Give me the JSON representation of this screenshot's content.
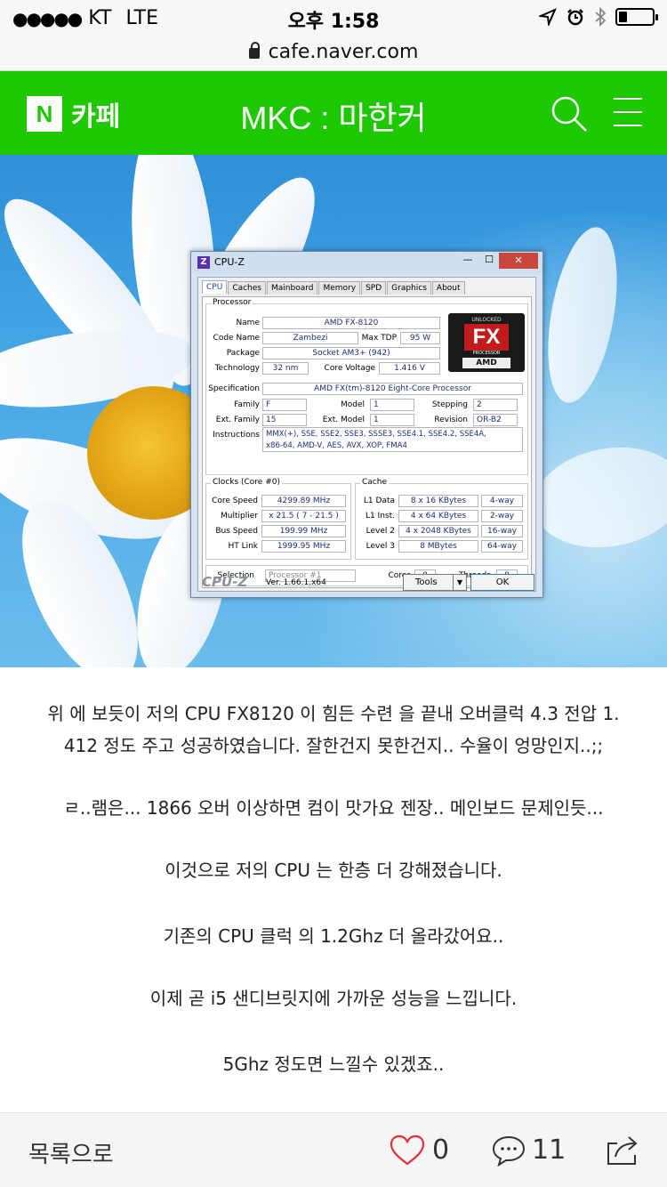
{
  "status_bar": {
    "signal": "●●●●●",
    "carrier": "KT",
    "network": "LTE",
    "time": "오후 1:58",
    "icons": [
      "location-arrow-icon",
      "alarm-icon",
      "bluetooth-icon",
      "battery-icon"
    ],
    "battery_level": 0.25
  },
  "url_bar": {
    "domain": "cafe.naver.com"
  },
  "header": {
    "logo_letter": "N",
    "logo_text": "카페",
    "title": "MKC : 마한커",
    "brand_color": "#1ec800"
  },
  "cpuz": {
    "title": "CPU-Z",
    "window_buttons": {
      "min": "—",
      "max": "☐",
      "close": "✕"
    },
    "tabs": [
      "CPU",
      "Caches",
      "Mainboard",
      "Memory",
      "SPD",
      "Graphics",
      "About"
    ],
    "active_tab": "CPU",
    "processor": {
      "group_label": "Processor",
      "name_label": "Name",
      "name": "AMD FX-8120",
      "codename_label": "Code Name",
      "codename": "Zambezi",
      "maxtdp_label": "Max TDP",
      "maxtdp": "95 W",
      "package_label": "Package",
      "package": "Socket AM3+ (942)",
      "technology_label": "Technology",
      "technology": "32 nm",
      "corevoltage_label": "Core Voltage",
      "corevoltage": "1.416 V",
      "spec_label": "Specification",
      "spec": "AMD FX(tm)-8120 Eight-Core Processor",
      "family_label": "Family",
      "family": "F",
      "model_label": "Model",
      "model": "1",
      "stepping_label": "Stepping",
      "stepping": "2",
      "extfamily_label": "Ext. Family",
      "extfamily": "15",
      "extmodel_label": "Ext. Model",
      "extmodel": "1",
      "revision_label": "Revision",
      "revision": "OR-B2",
      "instructions_label": "Instructions",
      "instructions_line1": "MMX(+), SSE, SSE2, SSE3, SSSE3, SSE4.1, SSE4.2, SSE4A,",
      "instructions_line2": "x86-64, AMD-V, AES, AVX, XOP, FMA4",
      "logo": {
        "unlocked": "UNLOCKED",
        "fx": "FX",
        "processor": "PROCESSOR",
        "amd": "AMD"
      }
    },
    "clocks": {
      "group_label": "Clocks (Core #0)",
      "corespeed_label": "Core Speed",
      "corespeed": "4299.89 MHz",
      "multiplier_label": "Multiplier",
      "multiplier": "x 21.5 ( 7 - 21.5 )",
      "busspeed_label": "Bus Speed",
      "busspeed": "199.99 MHz",
      "htlink_label": "HT Link",
      "htlink": "1999.95 MHz"
    },
    "cache": {
      "group_label": "Cache",
      "l1d_label": "L1 Data",
      "l1d": "8 x 16 KBytes",
      "l1d_way": "4-way",
      "l1i_label": "L1 Inst.",
      "l1i": "4 x 64 KBytes",
      "l1i_way": "2-way",
      "l2_label": "Level 2",
      "l2": "4 x 2048 KBytes",
      "l2_way": "16-way",
      "l3_label": "Level 3",
      "l3": "8 MBytes",
      "l3_way": "64-way"
    },
    "selection": {
      "label": "Selection",
      "value": "Processor #1",
      "cores_label": "Cores",
      "cores": "8",
      "threads_label": "Threads",
      "threads": "8"
    },
    "footer": {
      "brand": "CPU-Z",
      "version": "Ver. 1.66.1.x64",
      "tools": "Tools",
      "ok": "OK"
    }
  },
  "article": {
    "paragraphs": [
      "위 에 보듯이 저의 CPU FX8120 이 힘든 수련 을 끝내 오버클럭 4.3 전압 1.",
      "412 정도 주고 성공하였습니다. 잘한건지 못한건지.. 수율이 엉망인지..;;",
      "ㄹ..램은... 1866 오버 이상하면 컴이 맛가요 젠장.. 메인보드 문제인듯...",
      "이것으로 저의 CPU 는 한층 더 강해졌습니다.",
      "기존의 CPU 클럭 의 1.2Ghz 더 올라갔어요..",
      "이제 곧 i5 샌디브릿지에 가까운 성능을 느낍니다.",
      "5Ghz 정도면 느낄수 있겠죠.."
    ]
  },
  "bottom_bar": {
    "list_label": "목록으로",
    "like_count": "0",
    "comment_count": "11",
    "like_color": "#e0303a"
  }
}
